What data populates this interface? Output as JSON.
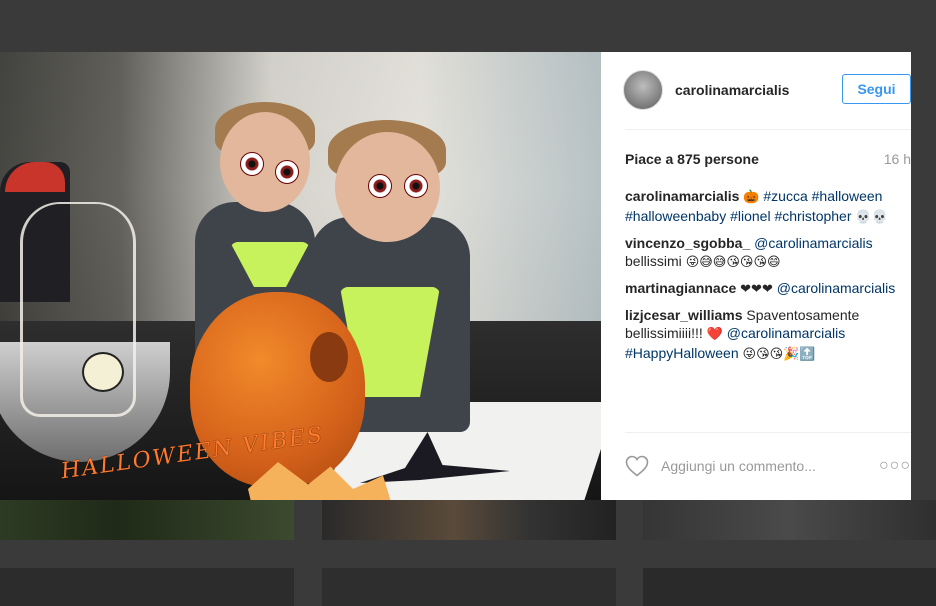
{
  "post": {
    "username": "carolinamarcialis",
    "follow_label": "Segui",
    "likes": "Piace a 875 persone",
    "time": "16 h"
  },
  "photo": {
    "sticker_text": "HALLOWEEN VIBES"
  },
  "comments": [
    {
      "author": "carolinamarcialis",
      "parts": [
        {
          "text": "🎃",
          "kind": "emoji"
        },
        {
          "text": "#zucca",
          "kind": "tag"
        },
        {
          "text": "#halloween",
          "kind": "tag"
        },
        {
          "text": "#halloweenbaby",
          "kind": "tag"
        },
        {
          "text": "#lionel",
          "kind": "tag"
        },
        {
          "text": "#christopher",
          "kind": "tag"
        },
        {
          "text": "💀💀",
          "kind": "emoji"
        }
      ]
    },
    {
      "author": "vincenzo_sgobba_",
      "parts": [
        {
          "text": "@carolinamarcialis",
          "kind": "tag"
        },
        {
          "text": "bellissimi",
          "kind": "text"
        },
        {
          "text": "😜😅😅😘😘😘😄",
          "kind": "emoji"
        }
      ]
    },
    {
      "author": "martinagiannace",
      "parts": [
        {
          "text": "❤❤❤",
          "kind": "emoji"
        },
        {
          "text": "@carolinamarcialis",
          "kind": "tag"
        }
      ]
    },
    {
      "author": "lizjcesar_williams",
      "parts": [
        {
          "text": "Spaventosamente bellissimiiii!!!",
          "kind": "text"
        },
        {
          "text": "❤️",
          "kind": "emoji"
        },
        {
          "text": "@carolinamarcialis",
          "kind": "tag"
        },
        {
          "text": "#HappyHalloween",
          "kind": "tag"
        },
        {
          "text": "😜😘😘🎉🔝",
          "kind": "emoji"
        }
      ]
    }
  ],
  "footer": {
    "add_comment_placeholder": "Aggiungi un commento...",
    "more_label": "○○○"
  },
  "icons": {
    "like": "heart-icon",
    "more": "more-options-icon"
  },
  "colors": {
    "link": "#003569",
    "follow_blue": "#3897f0"
  }
}
